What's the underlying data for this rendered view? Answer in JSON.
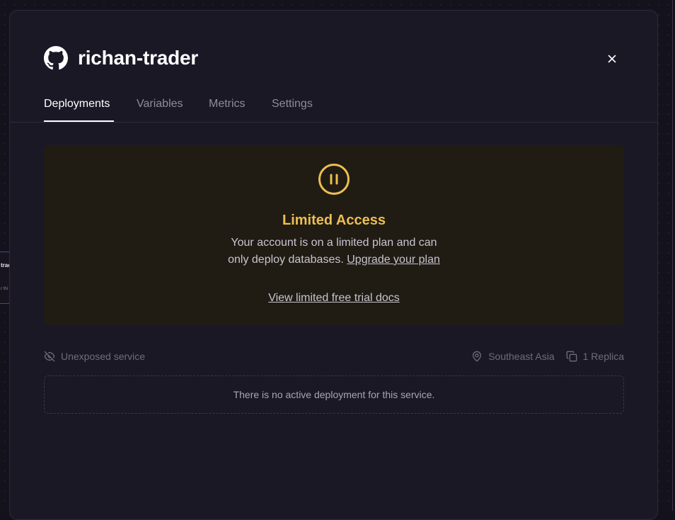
{
  "background_card": {
    "title": "trac",
    "subtitle": "r thi"
  },
  "service": {
    "icon": "github-icon",
    "name": "richan-trader"
  },
  "tabs": [
    {
      "label": "Deployments",
      "active": true
    },
    {
      "label": "Variables",
      "active": false
    },
    {
      "label": "Metrics",
      "active": false
    },
    {
      "label": "Settings",
      "active": false
    }
  ],
  "banner": {
    "icon": "pause-circle-icon",
    "title": "Limited Access",
    "line1": "Your account is on a limited plan and can",
    "line2_prefix": "only deploy databases.",
    "upgrade_link": "Upgrade your plan",
    "docs_link": "View limited free trial docs"
  },
  "meta": {
    "exposure_icon": "eye-off-icon",
    "exposure": "Unexposed service",
    "region_icon": "map-pin-icon",
    "region": "Southeast Asia",
    "replica_icon": "copy-icon",
    "replicas": "1 Replica"
  },
  "empty_state": "There is no active deployment for this service.",
  "colors": {
    "accent": "#edbe51",
    "modal_bg": "#1b1826",
    "banner_bg": "#201c14"
  }
}
